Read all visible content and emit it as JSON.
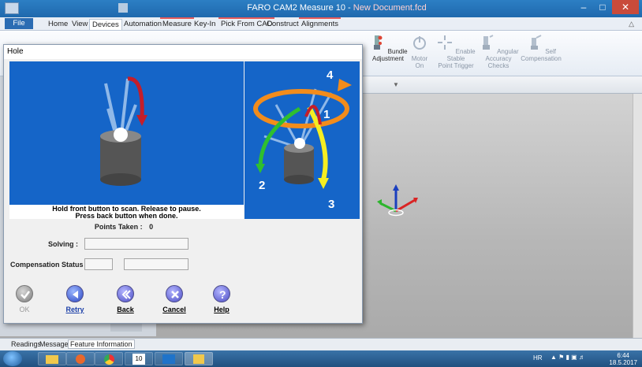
{
  "window": {
    "title_prefix": "FARO CAM2 Measure 10 - ",
    "title_doc": "New Document.fcd"
  },
  "ribbon_tabs": [
    {
      "label": "File"
    },
    {
      "label": "Home"
    },
    {
      "label": "View"
    },
    {
      "label": "Devices"
    },
    {
      "label": "Automation"
    },
    {
      "label": "Measure"
    },
    {
      "label": "Key-In"
    },
    {
      "label": "Pick From CAD"
    },
    {
      "label": "Construct"
    },
    {
      "label": "Alignments"
    }
  ],
  "ribbon_buttons": [
    {
      "label": "Bundle\nAdjustment",
      "enabled": true
    },
    {
      "label": "Motor\nOn",
      "enabled": false
    },
    {
      "label": "Enable Stable\nPoint Trigger",
      "enabled": false
    },
    {
      "label": "Angular Accuracy\nChecks",
      "enabled": false
    },
    {
      "label": "Self\nCompensation",
      "enabled": false
    }
  ],
  "dialog": {
    "title": "Hole",
    "instructions_line1": "Hold front button to scan.  Release to pause.",
    "instructions_line2": "Press back button when done.",
    "points_taken_label": "Points Taken :",
    "points_taken_value": "0",
    "solving_label": "Solving :",
    "compensation_label": "Compensation Status",
    "diagram_labels": [
      "1",
      "2",
      "3",
      "4"
    ],
    "buttons": [
      {
        "label": "OK",
        "enabled": false
      },
      {
        "label": "Retry",
        "enabled": true
      },
      {
        "label": "Back",
        "enabled": true
      },
      {
        "label": "Cancel",
        "enabled": true
      },
      {
        "label": "Help",
        "enabled": true
      }
    ]
  },
  "bottom_tabs": [
    {
      "label": "Readings"
    },
    {
      "label": "Messages"
    },
    {
      "label": "Feature Information"
    }
  ],
  "taskbar": {
    "lang": "HR",
    "time": "6:44",
    "date": "18.5.2017",
    "calendar_day": "10"
  },
  "colors": {
    "dialog_panel": "#1565c8",
    "titlebar": "#2374b8",
    "accent_orange": "#f28c1c",
    "accent_green": "#2fbf2f",
    "accent_yellow": "#f5ee22",
    "accent_red": "#d6202a"
  }
}
